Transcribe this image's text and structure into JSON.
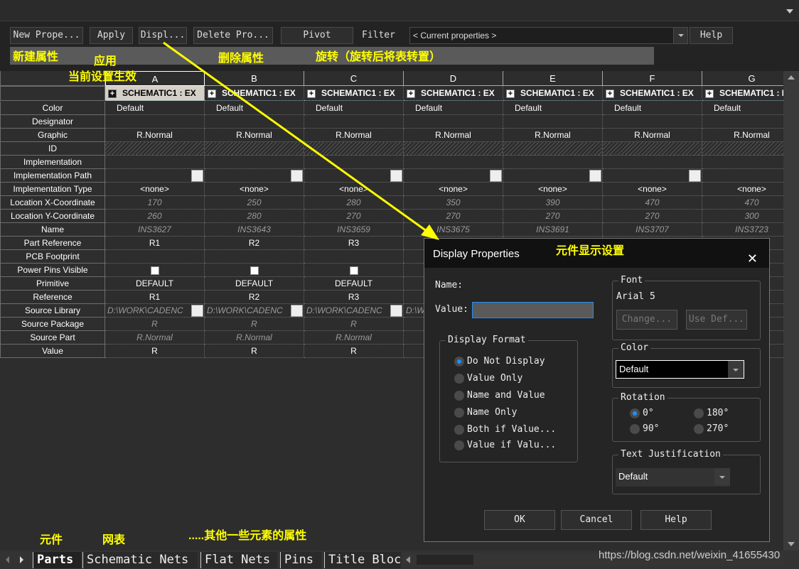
{
  "toolbar": {
    "new_property": "New Prope...",
    "apply": "Apply",
    "display": "Displ...",
    "delete_property": "Delete Pro...",
    "pivot": "Pivot",
    "filter_label": "Filter",
    "filter_value": "< Current properties >",
    "help": "Help"
  },
  "annotations": {
    "new_property": "新建属性",
    "apply": "应用",
    "apply_note": "当前设置生效",
    "delete_property": "删除属性",
    "pivot": "旋转（旋转后将表转置）",
    "dialog": "元件显示设置",
    "parts": "元件",
    "nets": "网表",
    "others": ".....其他一些元素的属性"
  },
  "grid": {
    "columns": [
      "A",
      "B",
      "C",
      "D",
      "E",
      "F",
      "G"
    ],
    "part_header": "SCHEMATIC1 : EX",
    "rows": [
      {
        "label": "Color",
        "kind": "left",
        "values": [
          "Default",
          "Default",
          "Default",
          "Default",
          "Default",
          "Default",
          "Default"
        ]
      },
      {
        "label": "Designator",
        "kind": "text",
        "values": [
          "",
          "",
          "",
          "",
          "",
          "",
          ""
        ]
      },
      {
        "label": "Graphic",
        "kind": "text",
        "values": [
          "R.Normal",
          "R.Normal",
          "R.Normal",
          "R.Normal",
          "R.Normal",
          "R.Normal",
          "R.Normal"
        ]
      },
      {
        "label": "ID",
        "kind": "hatch",
        "values": [
          "",
          "",
          "",
          "",
          "",
          "",
          ""
        ]
      },
      {
        "label": "Implementation",
        "kind": "text",
        "values": [
          "",
          "",
          "",
          "",
          "",
          "",
          ""
        ]
      },
      {
        "label": "Implementation Path",
        "kind": "button",
        "values": [
          "",
          "",
          "",
          "",
          "",
          "",
          ""
        ]
      },
      {
        "label": "Implementation Type",
        "kind": "text",
        "values": [
          "<none>",
          "<none>",
          "<none>",
          "<none>",
          "<none>",
          "<none>",
          "<none>"
        ]
      },
      {
        "label": "Location X-Coordinate",
        "kind": "ital",
        "values": [
          "170",
          "250",
          "280",
          "350",
          "390",
          "470",
          "470"
        ]
      },
      {
        "label": "Location Y-Coordinate",
        "kind": "ital",
        "values": [
          "260",
          "280",
          "270",
          "270",
          "270",
          "270",
          "300"
        ]
      },
      {
        "label": "Name",
        "kind": "ital",
        "values": [
          "INS3627",
          "INS3643",
          "INS3659",
          "INS3675",
          "INS3691",
          "INS3707",
          "INS3723"
        ]
      },
      {
        "label": "Part Reference",
        "kind": "text",
        "values": [
          "R1",
          "R2",
          "R3",
          "",
          "",
          "",
          ""
        ]
      },
      {
        "label": "PCB Footprint",
        "kind": "text",
        "values": [
          "",
          "",
          "",
          "",
          "",
          "",
          ""
        ]
      },
      {
        "label": "Power Pins Visible",
        "kind": "check",
        "values": [
          false,
          false,
          false
        ]
      },
      {
        "label": "Primitive",
        "kind": "text",
        "values": [
          "DEFAULT",
          "DEFAULT",
          "DEFAULT",
          "",
          "",
          "",
          ""
        ]
      },
      {
        "label": "Reference",
        "kind": "text",
        "values": [
          "R1",
          "R2",
          "R3",
          "",
          "",
          "",
          ""
        ]
      },
      {
        "label": "Source Library",
        "kind": "lib",
        "values": [
          "D:\\WORK\\CADENC",
          "D:\\WORK\\CADENC",
          "D:\\WORK\\CADENC",
          "D:\\WORK\\CADENC",
          "",
          "",
          ""
        ]
      },
      {
        "label": "Source Package",
        "kind": "ital",
        "values": [
          "R",
          "R",
          "R",
          "",
          "",
          "",
          ""
        ]
      },
      {
        "label": "Source Part",
        "kind": "ital",
        "values": [
          "R.Normal",
          "R.Normal",
          "R.Normal",
          "",
          "",
          "",
          ""
        ]
      },
      {
        "label": "Value",
        "kind": "text",
        "values": [
          "R",
          "R",
          "R",
          "",
          "",
          "",
          ""
        ]
      }
    ]
  },
  "tabs": [
    {
      "label": "Parts",
      "active": true
    },
    {
      "label": "Schematic Nets"
    },
    {
      "label": "Flat Nets"
    },
    {
      "label": "Pins"
    },
    {
      "label": "Title Bloc"
    }
  ],
  "watermark": "https://blog.csdn.net/weixin_41655430",
  "dialog": {
    "title": "Display Properties",
    "name_label": "Name:",
    "value_label": "Value:",
    "value": "",
    "display_format": {
      "title": "Display Format",
      "options": [
        "Do Not Display",
        "Value Only",
        "Name and Value",
        "Name Only",
        "Both if Value...",
        "Value if Valu..."
      ],
      "selected": 0
    },
    "font": {
      "title": "Font",
      "value": "Arial 5",
      "change": "Change...",
      "use_default": "Use Def..."
    },
    "color": {
      "title": "Color",
      "value": "Default"
    },
    "rotation": {
      "title": "Rotation",
      "options": [
        "0°",
        "180°",
        "90°",
        "270°"
      ],
      "selected": 0
    },
    "justification": {
      "title": "Text Justification",
      "value": "Default"
    },
    "ok": "OK",
    "cancel": "Cancel",
    "help": "Help"
  },
  "colors": {
    "annotation": "#ffff00",
    "accent": "#1e90ff"
  }
}
